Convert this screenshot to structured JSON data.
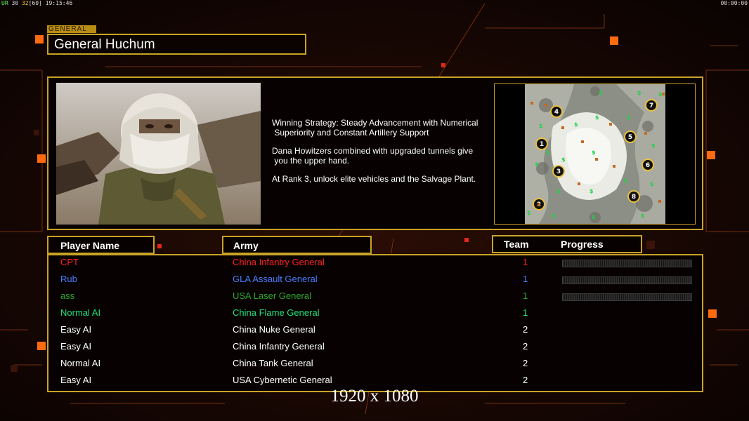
{
  "hud": {
    "left_a": "UR",
    "left_b": "30",
    "left_c": "32",
    "left_d": "[60]",
    "left_time": "19:15:46",
    "right_time": "00:00:00"
  },
  "tag": "GENERAL",
  "general_name": "General Huchum",
  "info": [
    "Winning Strategy: Steady Advancement with Numerical\n Superiority and Constant Artillery Support",
    "Dana Howitzers combined with upgraded tunnels give\n you the upper hand.",
    "At Rank 3, unlock elite vehicles and the Salvage Plant."
  ],
  "headers": {
    "player": "Player Name",
    "army": "Army",
    "team": "Team",
    "progress": "Progress"
  },
  "players": [
    {
      "name": "CPT",
      "army": "China Infantry General",
      "team": "1",
      "color": "#ff2020",
      "progress": 0
    },
    {
      "name": "Rub",
      "army": "GLA Assault General",
      "team": "1",
      "color": "#4a7dff",
      "progress": 0
    },
    {
      "name": "ass",
      "army": "USA Laser General",
      "team": "1",
      "color": "#2fa52f",
      "progress": 0
    },
    {
      "name": "Normal AI",
      "army": "China Flame General",
      "team": "1",
      "color": "#22e07a",
      "progress": null
    },
    {
      "name": "Easy AI",
      "army": "China Nuke General",
      "team": "2",
      "color": "#ffffff",
      "progress": null
    },
    {
      "name": "Easy AI",
      "army": "China Infantry General",
      "team": "2",
      "color": "#ffffff",
      "progress": null
    },
    {
      "name": "Normal AI",
      "army": "China Tank General",
      "team": "2",
      "color": "#ffffff",
      "progress": null
    },
    {
      "name": "Easy AI",
      "army": "USA Cybernetic General",
      "team": "2",
      "color": "#ffffff",
      "progress": null
    }
  ],
  "map_slots": [
    "1",
    "2",
    "3",
    "4",
    "5",
    "6",
    "7",
    "8"
  ],
  "resolution": "1920 x 1080",
  "colors": {
    "accent": "#c9a227",
    "bg": "#120603"
  }
}
